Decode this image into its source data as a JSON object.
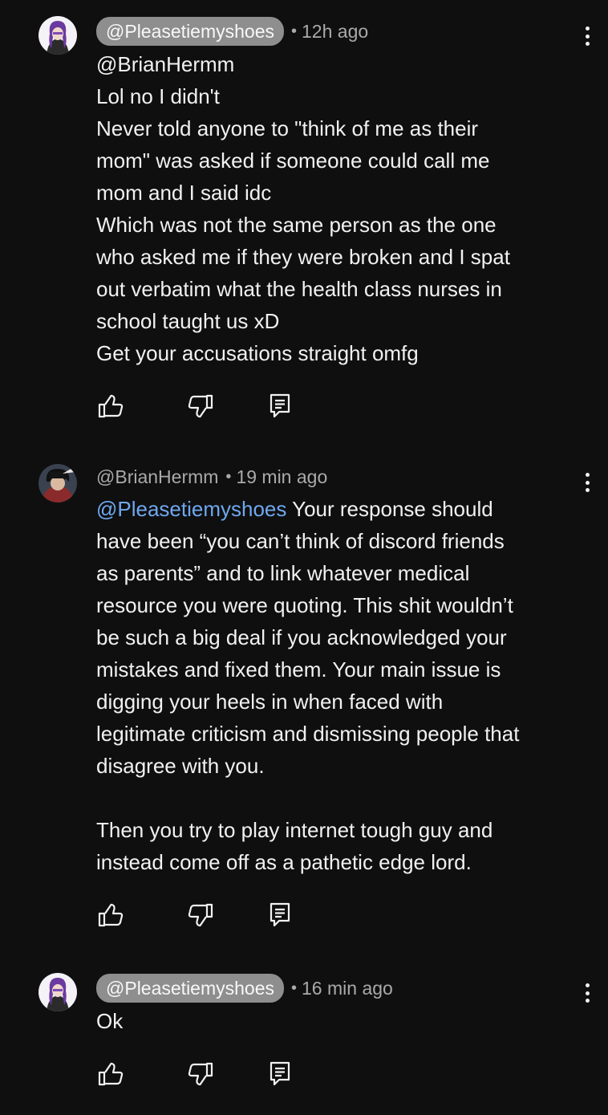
{
  "comments": [
    {
      "author": "@Pleasetiemyshoes",
      "is_creator_pill": true,
      "time": "12h ago",
      "lines": [
        "@BrianHermm",
        "Lol no I didn't",
        "Never told anyone to \"think of me as their",
        "mom\" was asked if someone could call me",
        "mom and I said idc",
        "Which was not the same person as the one",
        "who asked me if they were broken and I spat",
        "out verbatim what the health class nurses in",
        "school taught us xD",
        "Get your accusations straight omfg"
      ]
    },
    {
      "author": "@BrianHermm",
      "is_creator_pill": false,
      "time": "19 min ago",
      "mention": "@Pleasetiemyshoes",
      "first_line_rest": " Your response should",
      "lines": [
        "have been “you can’t think of discord friends",
        "as parents” and to link whatever medical",
        "resource you were quoting. This shit wouldn’t",
        "be such a big deal if you acknowledged your",
        "mistakes and fixed them. Your main issue is",
        "digging your heels in when faced with",
        "legitimate criticism and dismissing people that",
        "disagree with you.",
        "",
        "Then you try to play internet tough guy and",
        "instead come off as a pathetic edge lord."
      ]
    },
    {
      "author": "@Pleasetiemyshoes",
      "is_creator_pill": true,
      "time": "16 min ago",
      "lines": [
        "Ok"
      ]
    }
  ],
  "separator": "•",
  "icons": {
    "like": "thumbs-up-icon",
    "dislike": "thumbs-down-icon",
    "reply": "reply-comment-icon",
    "menu": "more-vertical-icon"
  },
  "colors": {
    "background": "#0f0f0f",
    "text": "#f1f1f1",
    "secondary": "#aaaaaa",
    "mention": "#6fa8f0",
    "creator_pill": "#8e8e8e"
  }
}
